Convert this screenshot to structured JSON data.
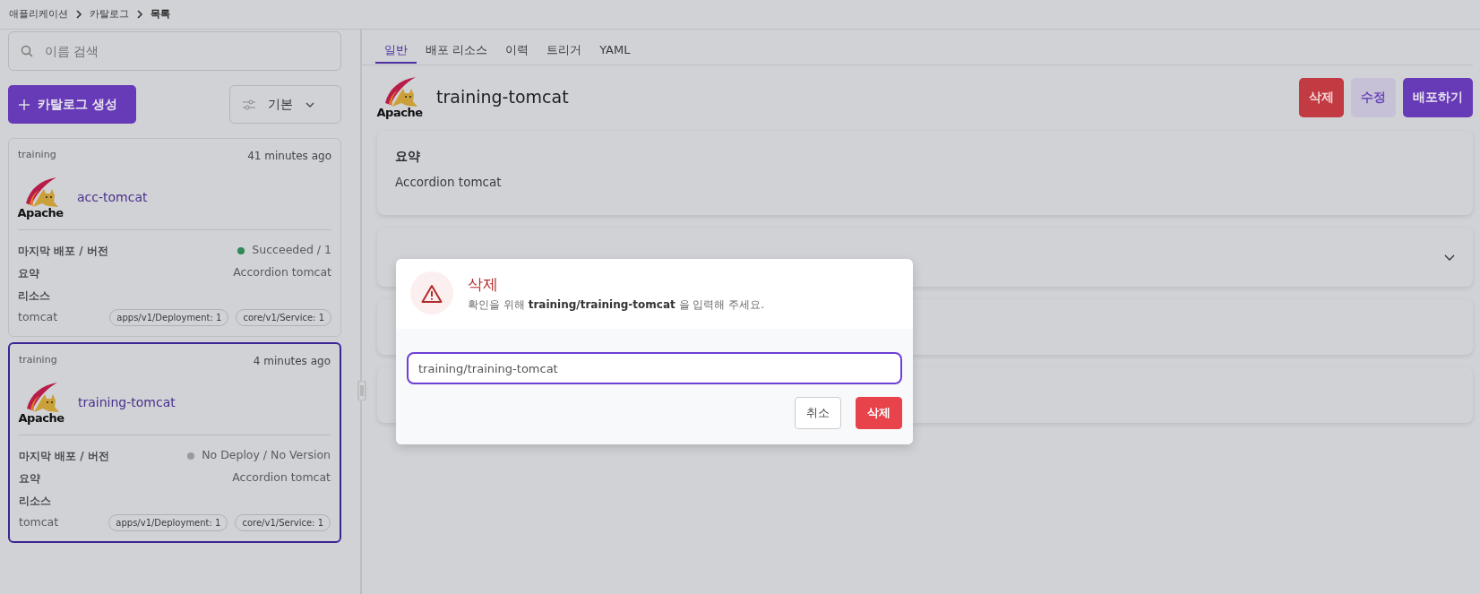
{
  "breadcrumb": [
    {
      "label": "애플리케이션",
      "current": false
    },
    {
      "label": "카탈로그",
      "current": false
    },
    {
      "label": "목록",
      "current": true
    }
  ],
  "sidebar": {
    "search": {
      "placeholder": "이름 검색"
    },
    "create_button": "카탈로그 생성",
    "sort": {
      "value": "기본"
    },
    "cards": [
      {
        "namespace": "training",
        "time": "41 minutes ago",
        "logo_text": "Apache",
        "name": "acc-tomcat",
        "selected": false,
        "deploy_label": "마지막 배포 / 버전",
        "status": "Succeeded / 1",
        "color": "#2e8b57",
        "summary_label": "요약",
        "summary": "Accordion tomcat",
        "resources_label": "리소스",
        "resource": "tomcat",
        "tags": [
          "apps/v1/Deployment: 1",
          "core/v1/Service: 1"
        ]
      },
      {
        "namespace": "training",
        "time": "4 minutes ago",
        "logo_text": "Apache",
        "name": "training-tomcat",
        "selected": true,
        "deploy_label": "마지막 배포 / 버전",
        "status": "No Deploy / No Version",
        "color": "#9a9a9e",
        "summary_label": "요약",
        "summary": "Accordion tomcat",
        "resources_label": "리소스",
        "resource": "tomcat",
        "tags": [
          "apps/v1/Deployment: 1",
          "core/v1/Service: 1"
        ]
      }
    ]
  },
  "tabs": [
    {
      "label": "일반",
      "selected": true
    },
    {
      "label": "배포 리소스",
      "selected": false
    },
    {
      "label": "이력",
      "selected": false
    },
    {
      "label": "트리거",
      "selected": false
    },
    {
      "label": "YAML",
      "selected": false
    }
  ],
  "detail": {
    "logo_text": "Apache",
    "title": "training-tomcat",
    "buttons": [
      {
        "label": "삭제",
        "kind": "danger"
      },
      {
        "label": "수정",
        "kind": "light"
      },
      {
        "label": "배포하기",
        "kind": "primary"
      }
    ],
    "sections": [
      {
        "kind": "text",
        "title": "요약",
        "text": "Accordion tomcat"
      },
      {
        "kind": "collapsible",
        "expanded": false
      },
      {
        "kind": "empty"
      },
      {
        "kind": "empty"
      }
    ]
  },
  "modal": {
    "title": "삭제",
    "message": "확인을 위해 **training/training-tomcat** 을 입력해 주세요.",
    "input": {
      "value": "training/training-tomcat"
    },
    "buttons": [
      {
        "label": "취소",
        "kind": "cancel"
      },
      {
        "label": "삭제",
        "kind": "danger"
      }
    ]
  }
}
